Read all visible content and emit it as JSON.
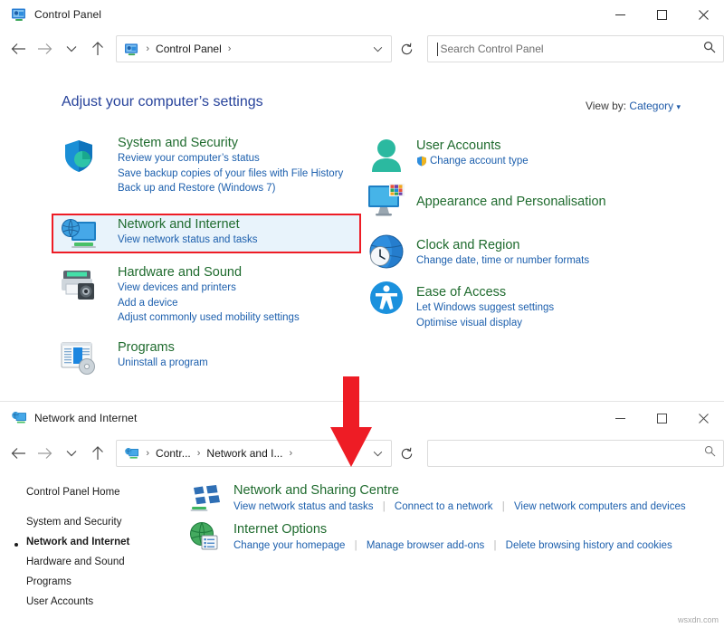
{
  "window_top": {
    "title": "Control Panel",
    "title_icon": "control-panel-icon",
    "controls": {
      "minimize": "—",
      "maximize": "☐",
      "close": "✕"
    },
    "nav": {
      "back": "←",
      "forward": "→",
      "recent": "∨",
      "up": "↑",
      "refresh": "↻"
    },
    "address": {
      "icon": "control-panel-icon",
      "sep": "›",
      "crumb": "Control Panel",
      "trailing_sep": "›",
      "chevron": "∨"
    },
    "search": {
      "placeholder": "Search Control Panel",
      "icon": "search-icon"
    },
    "heading": "Adjust your computer’s settings",
    "view_by": {
      "label": "View by:",
      "value": "Category",
      "arrow": "▾"
    },
    "categories_left": [
      {
        "icon": "shield-icon",
        "title": "System and Security",
        "links": [
          "Review your computer’s status",
          "Save backup copies of your files with File History",
          "Back up and Restore (Windows 7)"
        ]
      },
      {
        "icon": "network-monitor-icon",
        "title": "Network and Internet",
        "links": [
          "View network status and tasks"
        ],
        "highlighted": true
      },
      {
        "icon": "printer-icon",
        "title": "Hardware and Sound",
        "links": [
          "View devices and printers",
          "Add a device",
          "Adjust commonly used mobility settings"
        ]
      },
      {
        "icon": "programs-icon",
        "title": "Programs",
        "links": [
          "Uninstall a program"
        ]
      }
    ],
    "categories_right": [
      {
        "icon": "user-account-icon",
        "title": "User Accounts",
        "links": [
          "Change account type"
        ],
        "link_icons": [
          "uac-shield-icon"
        ]
      },
      {
        "icon": "appearance-icon",
        "title": "Appearance and Personalisation",
        "links": []
      },
      {
        "icon": "clock-region-icon",
        "title": "Clock and Region",
        "links": [
          "Change date, time or number formats"
        ]
      },
      {
        "icon": "ease-of-access-icon",
        "title": "Ease of Access",
        "links": [
          "Let Windows suggest settings",
          "Optimise visual display"
        ]
      }
    ]
  },
  "annotation": {
    "arrow": "down-arrow-annotation",
    "color": "#ee1c25",
    "highlight_color": "#ee1c25"
  },
  "window_bottom": {
    "title": "Network and Internet",
    "title_icon": "network-monitor-icon",
    "controls": {
      "minimize": "—",
      "maximize": "☐",
      "close": "✕"
    },
    "nav": {
      "back": "←",
      "forward": "→",
      "recent": "∨",
      "up": "↑",
      "refresh": "↻"
    },
    "address": {
      "icon": "network-monitor-icon",
      "sep": "›",
      "crumb1": "Contr...",
      "crumb2": "Network and I...",
      "trailing_sep": "›",
      "chevron": "∨"
    },
    "search": {
      "placeholder": "",
      "icon": "search-icon"
    },
    "sidebar": [
      {
        "label": "Control Panel Home",
        "selected": false
      },
      {
        "label": "System and Security",
        "selected": false
      },
      {
        "label": "Network and Internet",
        "selected": true
      },
      {
        "label": "Hardware and Sound",
        "selected": false
      },
      {
        "label": "Programs",
        "selected": false
      },
      {
        "label": "User Accounts",
        "selected": false
      }
    ],
    "items": [
      {
        "icon": "network-sharing-icon",
        "title": "Network and Sharing Centre",
        "links": [
          "View network status and tasks",
          "Connect to a network",
          "View network computers and devices"
        ]
      },
      {
        "icon": "internet-options-icon",
        "title": "Internet Options",
        "links": [
          "Change your homepage",
          "Manage browser add-ons",
          "Delete browsing history and cookies"
        ]
      }
    ]
  },
  "watermark": "wsxdn.com"
}
